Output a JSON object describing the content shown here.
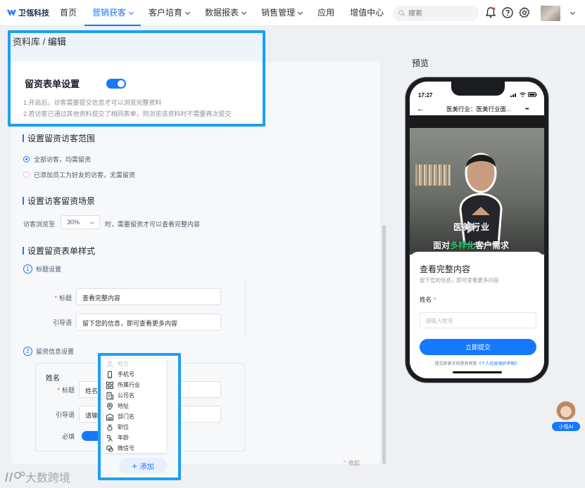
{
  "nav": {
    "brand": "卫瓴科技",
    "items": [
      {
        "label": "首页",
        "dropdown": false,
        "active": false
      },
      {
        "label": "营销获客",
        "dropdown": true,
        "active": true
      },
      {
        "label": "客户培育",
        "dropdown": true,
        "active": false
      },
      {
        "label": "数据报表",
        "dropdown": true,
        "active": false
      },
      {
        "label": "销售管理",
        "dropdown": true,
        "active": false
      },
      {
        "label": "应用",
        "dropdown": false,
        "active": false
      },
      {
        "label": "增值中心",
        "dropdown": false,
        "active": false
      }
    ],
    "search_placeholder": "搜索",
    "icons": [
      "bell-icon",
      "help-icon",
      "gear-icon"
    ],
    "accent": "#1677ff"
  },
  "breadcrumb": {
    "root": "资料库",
    "sep": " / ",
    "current": "编辑"
  },
  "lead_form": {
    "title": "留资表单设置",
    "enabled": true,
    "notes": [
      "1.开启后，访客需要提交信息才可以浏览完整资料",
      "2.若访客已通过其他资料提交了相同表单，则浏览该资料时不需要再次提交"
    ]
  },
  "scope": {
    "title": "设置留资访客范围",
    "options": [
      {
        "label": "全部访客，均需留资",
        "selected": true
      },
      {
        "label": "已添加员工为好友的访客，无需留资",
        "selected": false
      }
    ]
  },
  "scene": {
    "title": "设置访客留资场景",
    "prefix": "访客浏览至",
    "percent": "30%",
    "suffix": "时，需要留资才可以查看完整内容"
  },
  "style": {
    "title": "设置留资表单样式",
    "step1": {
      "num": "1",
      "label": "标题设置",
      "title_label": "标题",
      "title_value": "查看完整内容",
      "guide_label": "引导语",
      "guide_value": "留下您的信息，即可查看更多内容"
    },
    "step2": {
      "num": "2",
      "label": "留资信息设置",
      "field_name": "姓名",
      "title_label": "标题",
      "title_value": "姓名",
      "guide_label": "引导语",
      "guide_value": "请输",
      "required_label": "必填"
    },
    "collapse": "收起"
  },
  "dropdown": {
    "items": [
      {
        "label": "姓名",
        "icon": "user-icon",
        "disabled": true
      },
      {
        "label": "手机号",
        "icon": "phone-icon",
        "disabled": false
      },
      {
        "label": "所属行业",
        "icon": "grid-icon",
        "disabled": false
      },
      {
        "label": "公司名",
        "icon": "building-icon",
        "disabled": false
      },
      {
        "label": "地址",
        "icon": "location-icon",
        "disabled": false
      },
      {
        "label": "部门名",
        "icon": "department-icon",
        "disabled": false
      },
      {
        "label": "职位",
        "icon": "medal-icon",
        "disabled": false
      },
      {
        "label": "年龄",
        "icon": "age-icon",
        "disabled": false
      },
      {
        "label": "微信号",
        "icon": "wechat-icon",
        "disabled": false
      }
    ],
    "add_label": "添加"
  },
  "preview": {
    "title": "预览",
    "time": "17:27",
    "page_title": "医美行业：医美行业面...",
    "more": "•••",
    "video_text1": "医美行业",
    "video_text2_a": "面对",
    "video_text2_b": "多样化",
    "video_text2_c": "客户需求",
    "sheet_title": "查看完整内容",
    "sheet_sub": "留下您的信息，即可查看更多内容",
    "name_label": "姓名",
    "name_placeholder": "请输入姓名",
    "submit": "立即提交",
    "agree_a": "提交即表示同意并同意",
    "agree_b": "《个人信息保护声明》"
  },
  "ai_assistant": "小瓴AI",
  "watermark": "大数跨境"
}
